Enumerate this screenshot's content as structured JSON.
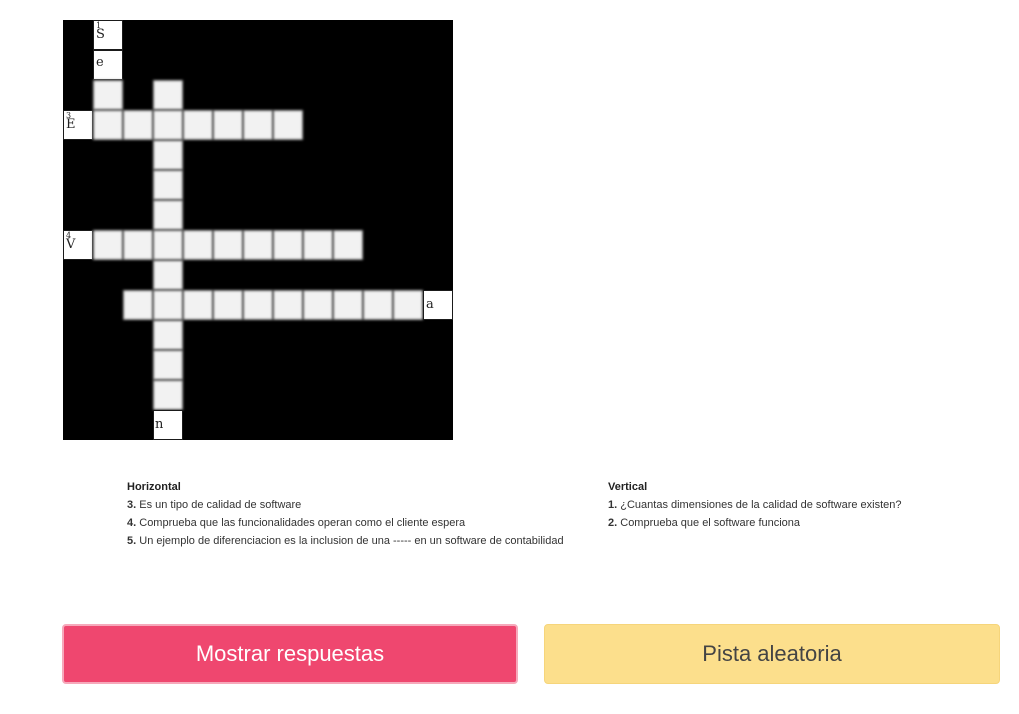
{
  "crossword": {
    "revealed": {
      "n1_number": "1",
      "n1_letter": "S",
      "row2_letter": "e",
      "n3_number": "3",
      "n3_letter": "E",
      "n4_number": "4",
      "n4_letter": "V",
      "row5_end_letter": "a",
      "col_bottom_letter": "n"
    }
  },
  "clues": {
    "horizontal": {
      "heading": "Horizontal",
      "items": [
        {
          "num": "3.",
          "text": "Es un tipo de calidad de software"
        },
        {
          "num": "4.",
          "text": "Comprueba que las funcionalidades operan como el cliente espera"
        },
        {
          "num": "5.",
          "text": "Un ejemplo de diferenciacion es la inclusion de una ----- en un software de contabilidad"
        }
      ]
    },
    "vertical": {
      "heading": "Vertical",
      "items": [
        {
          "num": "1.",
          "text": "¿Cuantas dimensiones de la calidad de software existen?"
        },
        {
          "num": "2.",
          "text": "Comprueba que el software funciona"
        }
      ]
    }
  },
  "buttons": {
    "show_answers": "Mostrar respuestas",
    "random_hint": "Pista aleatoria"
  },
  "colors": {
    "show_answers_bg": "#ef476f",
    "random_hint_bg": "#fcdf8c"
  }
}
